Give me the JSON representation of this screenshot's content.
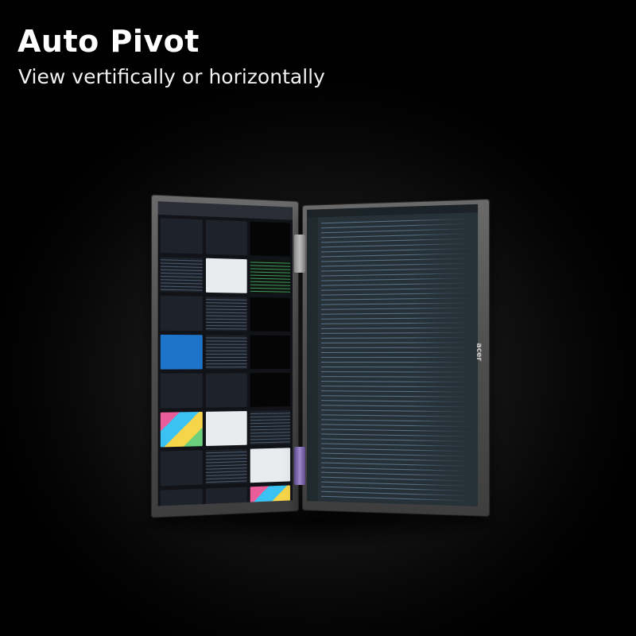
{
  "headline": {
    "title": "Auto Pivot",
    "subtitle": "View vertifically or horizontally"
  },
  "device": {
    "brand_mark": "acer",
    "left_screen": {
      "content": "image-gallery-grid",
      "tiles": [
        "t-dark",
        "t-dark",
        "t-video",
        "t-code",
        "t-white",
        "t-green",
        "t-dark",
        "t-code",
        "t-video",
        "t-blue",
        "t-code",
        "t-video",
        "t-dark",
        "t-dark",
        "t-video",
        "t-mix",
        "t-white",
        "t-code",
        "t-dark",
        "t-code",
        "t-white",
        "t-dark",
        "t-dark",
        "t-mix",
        "t-white",
        "t-code",
        "t-blue"
      ]
    },
    "right_screen": {
      "content": "code-editor"
    },
    "colors": {
      "bezel": "#555555",
      "editor_bg": "#263238",
      "hinge_accent": "#9c88cc"
    }
  }
}
